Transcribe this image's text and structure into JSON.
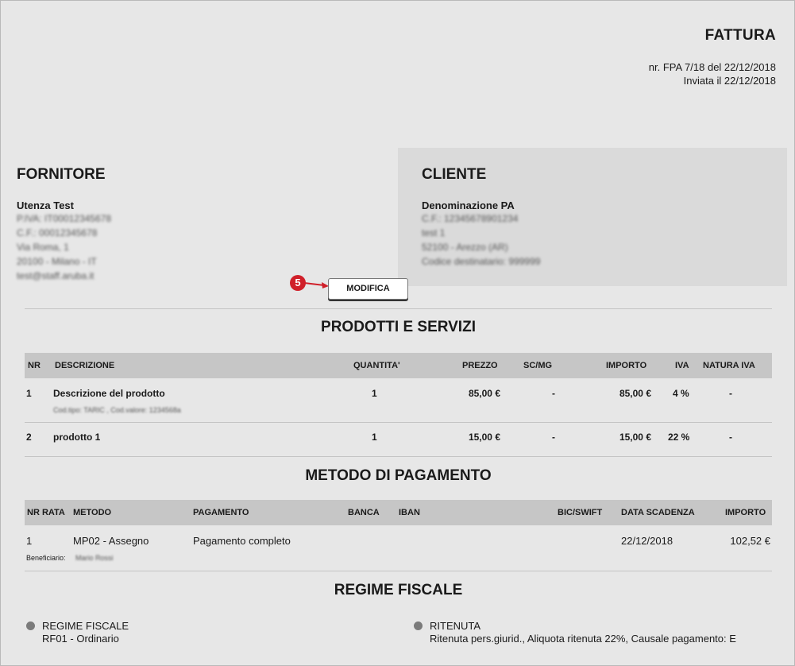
{
  "header": {
    "title": "FATTURA",
    "number_line": "nr. FPA 7/18 del 22/12/2018",
    "sent_line": "Inviata il 22/12/2018"
  },
  "fornitore": {
    "title": "FORNITORE",
    "name": "Utenza Test",
    "details": [
      "P.IVA: IT00012345678",
      "C.F.: 00012345678",
      "Via Roma, 1",
      "20100 - Milano - IT",
      "test@staff.aruba.it"
    ]
  },
  "cliente": {
    "title": "CLIENTE",
    "name": "Denominazione PA",
    "details": [
      "C.F.: 12345678901234",
      "test 1",
      "52100 - Arezzo (AR)",
      "Codice destinatario: 999999"
    ]
  },
  "edit": {
    "step_marker": "5",
    "button_label": "MODIFICA"
  },
  "products": {
    "title": "PRODOTTI E SERVIZI",
    "headers": {
      "nr": "NR",
      "descrizione": "DESCRIZIONE",
      "quantita": "QUANTITA'",
      "prezzo": "PREZZO",
      "scmg": "SC/MG",
      "importo": "IMPORTO",
      "iva": "IVA",
      "natura": "NATURA IVA"
    },
    "rows": [
      {
        "nr": "1",
        "descrizione": "Descrizione del prodotto",
        "sub": "Cod.tipo: TARIC , Cod.valore: 1234568a",
        "quantita": "1",
        "prezzo": "85,00 €",
        "scmg": "-",
        "importo": "85,00 €",
        "iva": "4 %",
        "natura": "-"
      },
      {
        "nr": "2",
        "descrizione": "prodotto 1",
        "sub": "",
        "quantita": "1",
        "prezzo": "15,00 €",
        "scmg": "-",
        "importo": "15,00 €",
        "iva": "22 %",
        "natura": "-"
      }
    ]
  },
  "payment": {
    "title": "METODO DI PAGAMENTO",
    "headers": {
      "nr_rata": "NR RATA",
      "metodo": "METODO",
      "pagamento": "PAGAMENTO",
      "banca": "BANCA",
      "iban": "IBAN",
      "bic": "BIC/SWIFT",
      "scadenza": "DATA SCADENZA",
      "importo": "IMPORTO"
    },
    "rows": [
      {
        "nr_rata": "1",
        "metodo": "MP02 - Assegno",
        "pagamento": "Pagamento completo",
        "scadenza": "22/12/2018",
        "importo": "102,52 €",
        "beneficiario_label": "Beneficiario:",
        "beneficiario_value": "Mario Rossi"
      }
    ]
  },
  "regime": {
    "title": "REGIME FISCALE",
    "left": {
      "label": "REGIME FISCALE",
      "value": "RF01 - Ordinario"
    },
    "right": {
      "label": "RITENUTA",
      "value": "Ritenuta pers.giurid., Aliquota ritenuta 22%, Causale pagamento: E"
    }
  },
  "colors": {
    "background": "#e7e7e7",
    "table_header": "#c6c6c6",
    "marker": "#d0202a"
  }
}
